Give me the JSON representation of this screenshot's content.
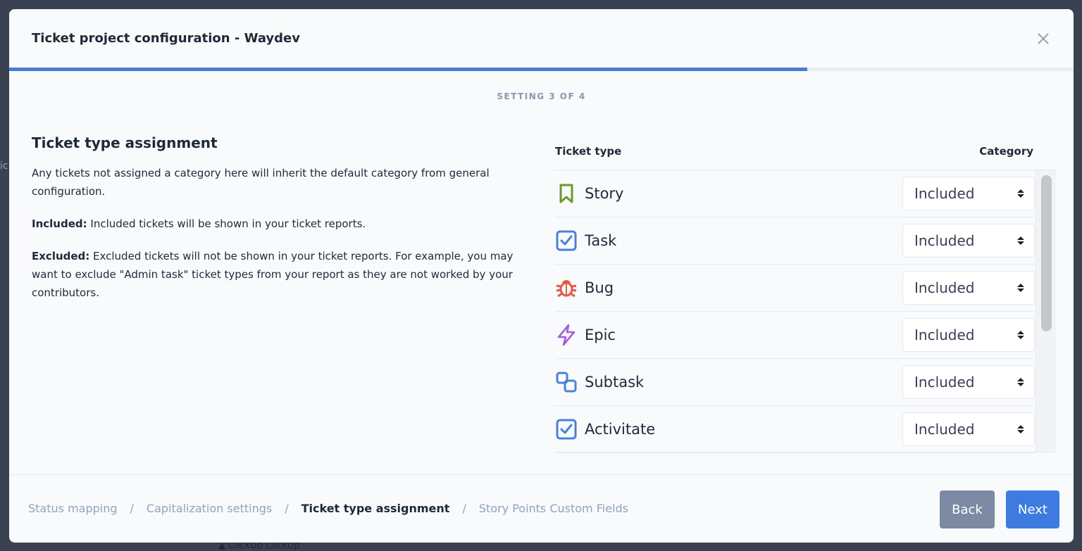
{
  "backdrop": {
    "side_text": "ic",
    "bottom_text": "▲ ClickUp  ClickUp"
  },
  "modal": {
    "title": "Ticket project configuration - Waydev",
    "progress": 0.75,
    "step_label": "SETTING 3 OF 4"
  },
  "left": {
    "title": "Ticket type assignment",
    "intro": "Any tickets not assigned a category here will inherit the default category from general configuration.",
    "included_label": "Included:",
    "included_text": " Included tickets will be shown in your ticket reports.",
    "excluded_label": "Excluded:",
    "excluded_text": " Excluded tickets will not be shown in your ticket reports. For example, you may want to exclude \"Admin task\" ticket types from your report as they are not worked by your contributors."
  },
  "table": {
    "col_type": "Ticket type",
    "col_category": "Category",
    "rows": [
      {
        "name": "Story",
        "icon": "bookmark-icon",
        "category": "Included",
        "color": "#6a9a2a"
      },
      {
        "name": "Task",
        "icon": "checkbox-icon",
        "category": "Included",
        "color": "#4a80d8"
      },
      {
        "name": "Bug",
        "icon": "bug-icon",
        "category": "Included",
        "color": "#e05a46"
      },
      {
        "name": "Epic",
        "icon": "lightning-icon",
        "category": "Included",
        "color": "#a55ed8"
      },
      {
        "name": "Subtask",
        "icon": "subtask-icon",
        "category": "Included",
        "color": "#4a80d8"
      },
      {
        "name": "Activitate",
        "icon": "checkbox-icon",
        "category": "Included",
        "color": "#4a80d8"
      }
    ]
  },
  "footer": {
    "crumbs": [
      "Status mapping",
      "Capitalization settings",
      "Ticket type assignment",
      "Story Points Custom Fields"
    ],
    "back": "Back",
    "next": "Next"
  },
  "colors": {
    "accent": "#3d7be0",
    "progress": "#4a7bd9"
  }
}
